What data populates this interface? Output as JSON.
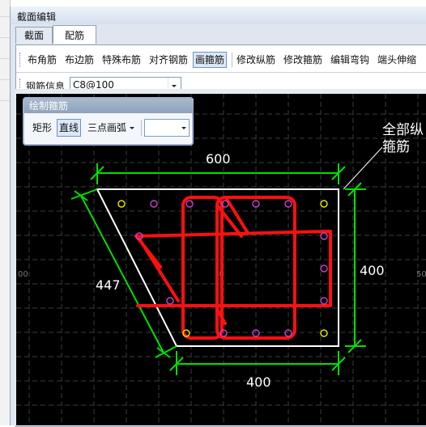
{
  "window": {
    "title": "截面编辑"
  },
  "tabs": [
    {
      "label": "截面",
      "active": false
    },
    {
      "label": "配筋",
      "active": true
    }
  ],
  "toolbar": {
    "items": [
      {
        "label": "布角筋",
        "active": false
      },
      {
        "label": "布边筋",
        "active": false
      },
      {
        "label": "特殊布筋",
        "active": false
      },
      {
        "label": "对齐钢筋",
        "active": false
      },
      {
        "label": "画箍筋",
        "active": true
      },
      {
        "label": "修改纵筋",
        "active": false
      },
      {
        "label": "修改箍筋",
        "active": false
      },
      {
        "label": "编辑弯钩",
        "active": false
      },
      {
        "label": "端头伸缩",
        "active": false
      }
    ]
  },
  "rebar_info": {
    "label": "钢筋信息",
    "value": "C8@100"
  },
  "draw_stirrup_panel": {
    "title": "绘制箍筋",
    "buttons": [
      {
        "label": "矩形",
        "active": false
      },
      {
        "label": "直线",
        "active": true
      },
      {
        "label": "三点画弧",
        "active": false
      }
    ],
    "combo_value": ""
  },
  "canvas": {
    "annotation": "全部纵\n箍筋",
    "annotation_line1": "全部纵",
    "annotation_line2": "箍筋",
    "dim_top": "600",
    "dim_bottom": "400",
    "dim_right": "400",
    "dim_slant": "447",
    "axis_labels": {
      "left": "00",
      "center": "0",
      "right": "50"
    },
    "colors": {
      "background": "#000000",
      "grid": "#3a3a3a",
      "outline": "#ffffff",
      "dimension": "#00e000",
      "stirrup": "#ff1010",
      "longitudinal_rebar": "#c040c0",
      "corner_rebar": "#e0e000"
    }
  }
}
